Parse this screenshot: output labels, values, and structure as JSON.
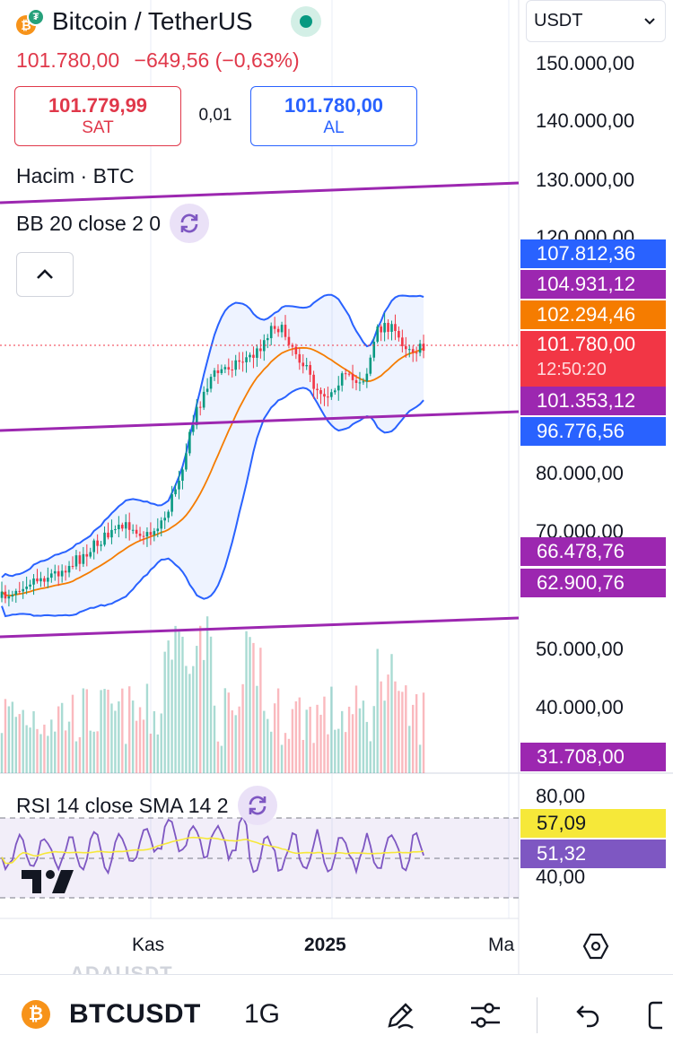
{
  "header": {
    "title": "Bitcoin / TetherUS",
    "price": "101.780,00",
    "change": "−649,56 (−0,63%)",
    "sell": {
      "price": "101.779,99",
      "label": "SAT"
    },
    "spread": "0,01",
    "buy": {
      "price": "101.780,00",
      "label": "AL"
    },
    "currency": "USDT",
    "icons": [
      "btc-coin-icon",
      "tether-coin-icon",
      "market-open-icon",
      "chevron-down-icon"
    ]
  },
  "indicators": {
    "volume": "Hacim · BTC",
    "bb": "BB 20 close 2 0",
    "rsi": "RSI 14 close SMA 14 2"
  },
  "price_axis": {
    "ticks": [
      "150.000,00",
      "140.000,00",
      "130.000,00",
      "120.000,00",
      "80.000,00",
      "70.000,00",
      "50.000,00",
      "40.000,00"
    ]
  },
  "price_labels": [
    {
      "value": "107.812,36",
      "color": "#2962ff"
    },
    {
      "value": "104.931,12",
      "color": "#9c27b0"
    },
    {
      "value": "102.294,46",
      "color": "#f57c00"
    },
    {
      "value": "101.780,00",
      "sub": "12:50:20",
      "color": "#f23645"
    },
    {
      "value": "101.353,12",
      "color": "#9c27b0"
    },
    {
      "value": "96.776,56",
      "color": "#2962ff"
    },
    {
      "value": "66.478,76",
      "color": "#9c27b0"
    },
    {
      "value": "62.900,76",
      "color": "#9c27b0"
    },
    {
      "value": "31.708,00",
      "color": "#9c27b0"
    }
  ],
  "rsi_axis": {
    "ticks": [
      "80,00",
      "40,00"
    ]
  },
  "rsi_labels": [
    {
      "value": "57,09",
      "color": "#f6e839",
      "text_color": "#131722"
    },
    {
      "value": "51,32",
      "color": "#7e57c2",
      "text_color": "#ffffff"
    }
  ],
  "time_axis": {
    "ticks": [
      "Kas",
      "2025",
      "Ma"
    ]
  },
  "bottom_bar": {
    "ghost_symbol": "ADAUSDT",
    "symbol": "BTCUSDT",
    "interval": "1G",
    "icons": [
      "drawing-pen-icon",
      "indicator-settings-icon",
      "undo-icon",
      "fullscreen-icon"
    ]
  },
  "colors": {
    "up": "#089981",
    "down": "#f23645",
    "bb_band": "#2962ff",
    "bb_basis": "#f57c00",
    "trendline": "#9c27b0",
    "rsi_line": "#7e57c2",
    "rsi_sma": "#f6e839"
  }
}
